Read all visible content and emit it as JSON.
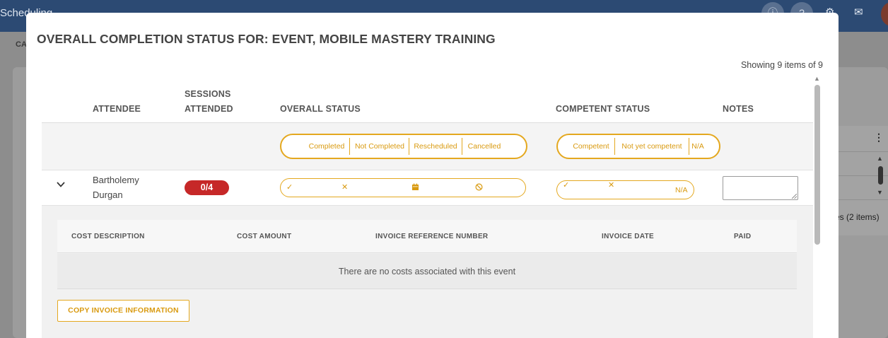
{
  "background": {
    "app_title": "Scheduling",
    "crumb": "CA",
    "items_fragment": "es (2 items)",
    "menu_glyph": "⋮"
  },
  "modal": {
    "title": "OVERALL COMPLETION STATUS FOR: EVENT, MOBILE MASTERY TRAINING",
    "showing": "Showing 9 items of 9"
  },
  "columns": {
    "attendee": "ATTENDEE",
    "sessions_line1": "SESSIONS",
    "sessions_line2": "ATTENDED",
    "overall_status": "OVERALL STATUS",
    "competent_status": "COMPETENT STATUS",
    "notes": "NOTES"
  },
  "legend": {
    "overall": [
      "Completed",
      "Not Completed",
      "Rescheduled",
      "Cancelled"
    ],
    "competent": [
      "Competent",
      "Not yet competent",
      "N/A"
    ]
  },
  "attendee": {
    "first_name": "Bartholemy",
    "last_name": "Durgan",
    "sessions": "0/4",
    "notes_value": "",
    "competent_na": "N/A"
  },
  "costs": {
    "headers": [
      "COST DESCRIPTION",
      "COST AMOUNT",
      "INVOICE REFERENCE NUMBER",
      "INVOICE DATE",
      "PAID"
    ],
    "empty_message": "There are no costs associated with this event",
    "copy_button": "COPY INVOICE INFORMATION"
  },
  "colors": {
    "accent": "#e4a81f",
    "badge": "#c62828",
    "topbar": "#2c4a73"
  }
}
